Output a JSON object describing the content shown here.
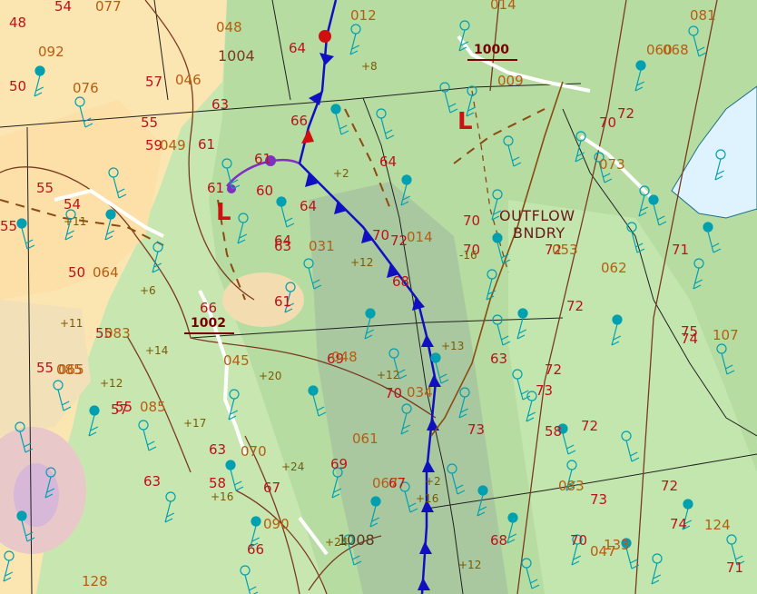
{
  "colors": {
    "temperature": "#c0101a",
    "dewpoint": "#1a8a22",
    "pressure": "#b85c10",
    "station": "#00a0b0",
    "cold_front": "#1010c0",
    "warm_front": "#d01010",
    "occluded_front": "#8030c0",
    "isobar": "#7a3a20",
    "outflow": "#ffffff",
    "lake": "#dff3ff"
  },
  "isobars": [
    {
      "label": "1000",
      "value": 1000
    },
    {
      "label": "1002",
      "value": 1002
    },
    {
      "label": "1004",
      "value": 1004
    },
    {
      "label": "1008",
      "value": 1008
    }
  ],
  "lows": [
    {
      "label": "L",
      "id": "low-west"
    },
    {
      "label": "L",
      "id": "low-north"
    }
  ],
  "fronts": [
    {
      "type": "cold",
      "icon": "cold-front-icon"
    },
    {
      "type": "warm",
      "icon": "warm-front-icon"
    },
    {
      "type": "occluded",
      "icon": "occluded-front-icon"
    }
  ],
  "boundary_label": {
    "line1": "OUTFLOW",
    "line2": "BNDRY"
  },
  "temperatures": [
    "48",
    "54",
    "50",
    "57",
    "63",
    "59",
    "54",
    "50",
    "55",
    "55",
    "61",
    "61",
    "55",
    "55",
    "63",
    "64",
    "66",
    "61",
    "63",
    "64",
    "64",
    "70",
    "61",
    "69",
    "72",
    "70",
    "67",
    "68",
    "63",
    "70",
    "69",
    "70",
    "72",
    "72",
    "73",
    "72",
    "71",
    "74",
    "73",
    "72",
    "70",
    "73",
    "75",
    "72",
    "74",
    "71",
    "66",
    "67",
    "57",
    "58",
    "55",
    "60",
    "58",
    "63",
    "55",
    "64",
    "66",
    "68",
    "70",
    "72"
  ],
  "pressures": [
    "077",
    "092",
    "076",
    "046",
    "049",
    "012",
    "014",
    "048",
    "064",
    "083",
    "085",
    "085",
    "065",
    "031",
    "061",
    "048",
    "045",
    "067",
    "070",
    "014",
    "083",
    "053",
    "062",
    "081",
    "068",
    "073",
    "107",
    "124",
    "133",
    "128",
    "090",
    "047",
    "009",
    "034",
    "060"
  ],
  "tendencies": [
    "+8",
    "+2",
    "+11",
    "+6",
    "+11",
    "+12",
    "+14",
    "+16",
    "+17",
    "+12",
    "+20",
    "+12",
    "+24",
    "+24",
    "+16",
    "-16",
    "+12",
    "+13",
    "+2"
  ]
}
